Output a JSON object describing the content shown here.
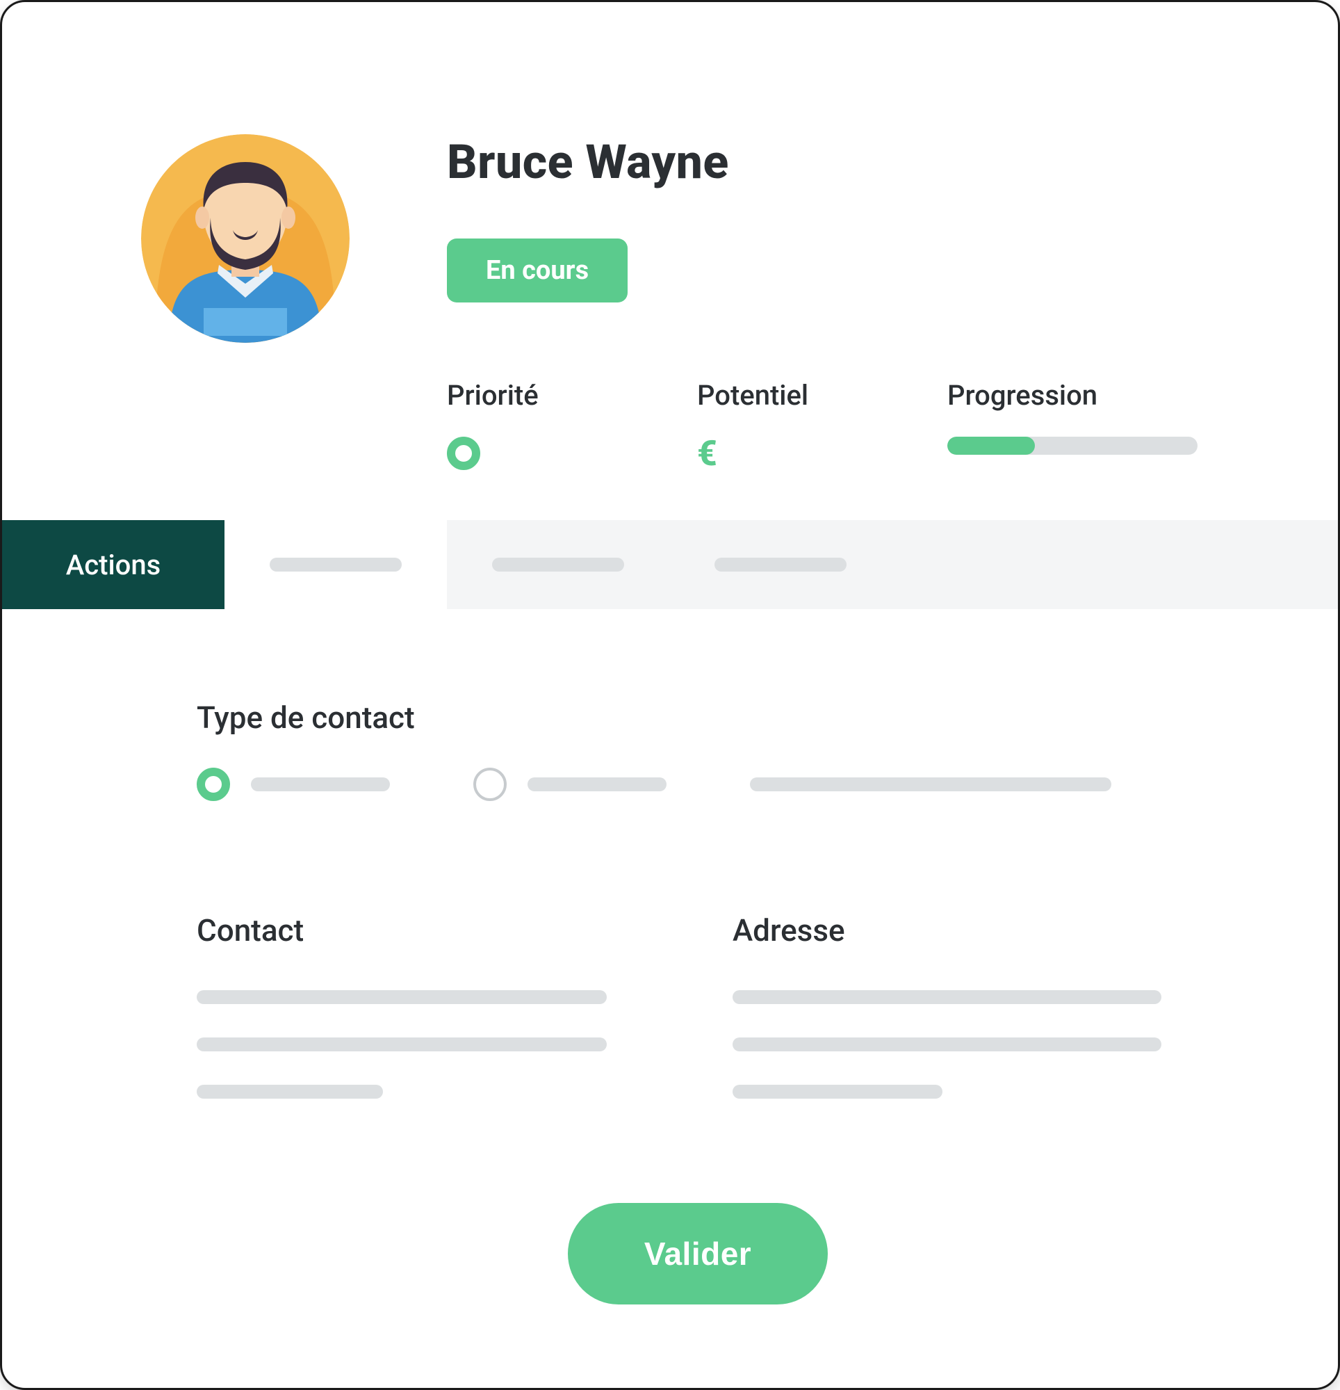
{
  "header": {
    "name": "Bruce Wayne",
    "status_label": "En cours",
    "priority_label": "Priorité",
    "potential_label": "Potentiel",
    "potential_symbol": "€",
    "progression_label": "Progression",
    "progression_percent": 35
  },
  "tabs": {
    "active_label": "Actions"
  },
  "form": {
    "contact_type_label": "Type de contact",
    "contact_label": "Contact",
    "address_label": "Adresse",
    "validate_label": "Valider"
  },
  "colors": {
    "accent": "#5BCB8D",
    "tab_active_bg": "#0D4944"
  }
}
